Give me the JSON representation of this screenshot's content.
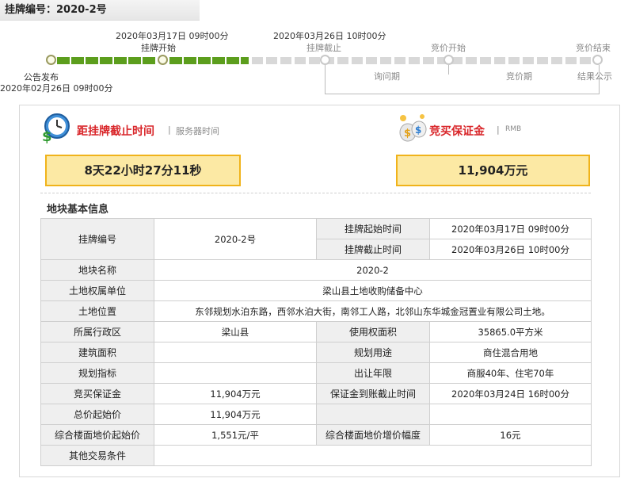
{
  "header": {
    "title": "挂牌编号：2020-2号"
  },
  "timeline": {
    "publish_label": "公告发布",
    "publish_time": "2020年02月26日 09时00分",
    "start_label": "挂牌开始",
    "start_time": "2020年03月17日 09时00分",
    "end_label": "挂牌截止",
    "end_time": "2020年03月26日 10时00分",
    "bid_start_label": "竞价开始",
    "bid_end_label": "竞价结束",
    "inquiry_label": "询问期",
    "bidding_label": "竞价期",
    "result_label": "结果公示"
  },
  "countdown": {
    "title": "距挂牌截止时间",
    "subtitle": "服务器时间",
    "value": "8天22小时27分11秒",
    "icon": "clock-money-icon"
  },
  "deposit": {
    "title": "竞买保证金",
    "subtitle": "RMB",
    "value": "11,904万元",
    "icon": "money-bags-icon"
  },
  "section": {
    "title": "地块基本信息"
  },
  "table": {
    "r1": {
      "label": "挂牌编号",
      "value": "2020-2号"
    },
    "r1a": {
      "label": "挂牌起始时间",
      "value": "2020年03月17日 09时00分"
    },
    "r1b": {
      "label": "挂牌截止时间",
      "value": "2020年03月26日 10时00分"
    },
    "r2": {
      "label": "地块名称",
      "value": "2020-2"
    },
    "r3": {
      "label": "土地权属单位",
      "value": "梁山县土地收购储备中心"
    },
    "r4": {
      "label": "土地位置",
      "value": "东邻规划水泊东路，西邻水泊大街，南邻工人路，北邻山东华城金冠置业有限公司土地。"
    },
    "r5": {
      "label": "所属行政区",
      "value": "梁山县",
      "label2": "使用权面积",
      "value2": "35865.0平方米"
    },
    "r6": {
      "label": "建筑面积",
      "value": "",
      "label2": "规划用途",
      "value2": "商住混合用地"
    },
    "r7": {
      "label": "规划指标",
      "value": "",
      "label2": "出让年限",
      "value2": "商服40年、住宅70年"
    },
    "r8": {
      "label": "竞买保证金",
      "value": "11,904万元",
      "label2": "保证金到账截止时间",
      "value2": "2020年03月24日 16时00分"
    },
    "r9": {
      "label": "总价起始价",
      "value": "11,904万元",
      "label2": "",
      "value2": ""
    },
    "r10": {
      "label": "综合楼面地价起始价",
      "value": "1,551元/平",
      "label2": "综合楼面地价增价幅度",
      "value2": "16元"
    },
    "r11": {
      "label": "其他交易条件",
      "value": ""
    }
  },
  "colors": {
    "accent_red": "#d9262a",
    "progress_green": "#5c9e1d",
    "box_yellow": "#fce9a4",
    "box_border": "#f0b31b"
  }
}
